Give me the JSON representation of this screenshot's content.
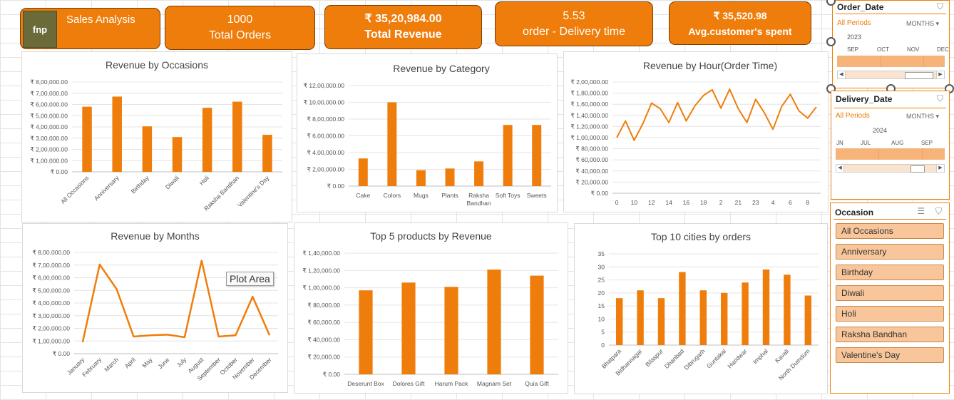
{
  "kpis": {
    "title": "Sales Analysis",
    "logo_text": "fnp",
    "orders_value": "1000",
    "orders_label": "Total Orders",
    "revenue_value": "₹ 35,20,984.00",
    "revenue_label": "Total Revenue",
    "delivery_value": "5.53",
    "delivery_label": "order - Delivery time",
    "spent_value": "₹ 35,520.98",
    "spent_label": "Avg.customer's spent"
  },
  "tooltip": "Plot Area",
  "slicers": {
    "order_date": {
      "title": "Order_Date",
      "all_periods": "All Periods",
      "unit": "MONTHS",
      "year": "2023",
      "months": [
        "SEP",
        "OCT",
        "NOV",
        "DEC"
      ]
    },
    "delivery_date": {
      "title": "Delivery_Date",
      "all_periods": "All Periods",
      "unit": "MONTHS",
      "year": "2024",
      "months": [
        "JN",
        "JUL",
        "AUG",
        "SEP"
      ]
    },
    "occasion": {
      "title": "Occasion",
      "items": [
        "All Occasions",
        "Anniversary",
        "Birthday",
        "Diwali",
        "Holi",
        "Raksha Bandhan",
        "Valentine's Day"
      ]
    }
  },
  "colors": {
    "accent": "#ef7d0b",
    "bar": "#ef7d0b"
  },
  "chart_data": [
    {
      "id": "occasions",
      "type": "bar",
      "title": "Revenue by Occasions",
      "categories": [
        "All Occasions",
        "Anniversary",
        "Birthday",
        "Diwali",
        "Holi",
        "Raksha Bandhan",
        "Valentine's Day"
      ],
      "values": [
        580000,
        670000,
        405000,
        310000,
        570000,
        625000,
        330000
      ],
      "ylim": [
        0,
        800000
      ],
      "step": 100000,
      "yticks_fmt": "₹ {v}",
      "rotate_labels": true
    },
    {
      "id": "category",
      "type": "bar",
      "title": "Revenue by Category",
      "categories": [
        "Cake",
        "Colors",
        "Mugs",
        "Plants",
        "Raksha Bandhan",
        "Soft Toys",
        "Sweets"
      ],
      "values": [
        330000,
        1000000,
        190000,
        210000,
        295000,
        730000,
        730000
      ],
      "ylim": [
        0,
        1200000
      ],
      "step": 200000,
      "rotate_labels": false
    },
    {
      "id": "hour",
      "type": "line",
      "title": "Revenue by Hour(Order Time)",
      "categories": [
        "0",
        "1",
        "10",
        "11",
        "12",
        "13",
        "14",
        "15",
        "16",
        "17",
        "18",
        "19",
        "2",
        "20",
        "21",
        "22",
        "23",
        "3",
        "4",
        "5",
        "6",
        "7",
        "8",
        "9"
      ],
      "xtick_labels": [
        "0",
        "10",
        "12",
        "14",
        "16",
        "18",
        "2",
        "21",
        "23",
        "4",
        "6",
        "8"
      ],
      "values": [
        100000,
        130000,
        95000,
        125000,
        162000,
        152000,
        127000,
        163000,
        130000,
        157000,
        176000,
        186000,
        153000,
        187000,
        152000,
        127000,
        169000,
        145000,
        115000,
        156000,
        178000,
        148000,
        135000,
        155000
      ],
      "ylim": [
        0,
        200000
      ],
      "step": 20000
    },
    {
      "id": "months",
      "type": "line",
      "title": "Revenue by Months",
      "categories": [
        "January",
        "February",
        "March",
        "April",
        "May",
        "June",
        "July",
        "August",
        "September",
        "October",
        "November",
        "December"
      ],
      "values": [
        90000,
        705000,
        510000,
        135000,
        145000,
        150000,
        130000,
        735000,
        135000,
        145000,
        450000,
        145000
      ],
      "ylim": [
        0,
        800000
      ],
      "step": 100000,
      "rotate_labels": true
    },
    {
      "id": "products",
      "type": "bar",
      "title": "Top 5 products by Revenue",
      "categories": [
        "Deserunt Box",
        "Dolores Gift",
        "Harum Pack",
        "Magnam Set",
        "Quia Gift"
      ],
      "values": [
        97000,
        106000,
        101000,
        121000,
        114000
      ],
      "ylim": [
        0,
        140000
      ],
      "step": 20000,
      "rotate_labels": false
    },
    {
      "id": "cities",
      "type": "bar",
      "title": "Top 10 cities by orders",
      "categories": [
        "Bhatpara",
        "Bidhannagar",
        "Bilaspur",
        "Dhanbad",
        "Dibrugarh",
        "Guntakal",
        "Haridwar",
        "Imphal",
        "Kavali",
        "North Dumdum"
      ],
      "values": [
        18,
        21,
        18,
        28,
        21,
        20,
        24,
        29,
        27,
        19
      ],
      "ylim": [
        0,
        35
      ],
      "step": 5,
      "rotate_labels": true
    }
  ]
}
